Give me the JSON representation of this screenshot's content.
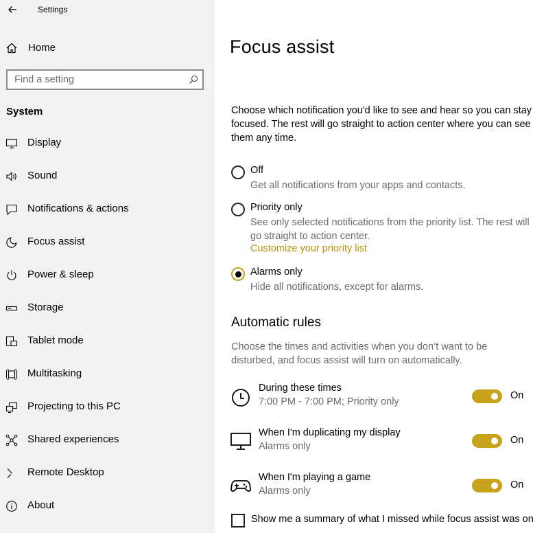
{
  "window": {
    "title": "Settings"
  },
  "sidebar": {
    "home_label": "Home",
    "search": {
      "placeholder": "Find a setting"
    },
    "section": "System",
    "items": [
      {
        "label": "Display",
        "icon": "display-icon"
      },
      {
        "label": "Sound",
        "icon": "speaker-icon"
      },
      {
        "label": "Notifications & actions",
        "icon": "notification-icon"
      },
      {
        "label": "Focus assist",
        "icon": "moon-icon"
      },
      {
        "label": "Power & sleep",
        "icon": "power-icon"
      },
      {
        "label": "Storage",
        "icon": "storage-icon"
      },
      {
        "label": "Tablet mode",
        "icon": "tablet-mode-icon"
      },
      {
        "label": "Multitasking",
        "icon": "multitasking-icon"
      },
      {
        "label": "Projecting to this PC",
        "icon": "projecting-icon"
      },
      {
        "label": "Shared experiences",
        "icon": "shared-experiences-icon"
      },
      {
        "label": "Remote Desktop",
        "icon": "remote-desktop-icon"
      },
      {
        "label": "About",
        "icon": "info-icon"
      }
    ]
  },
  "main": {
    "title": "Focus assist",
    "intro": "Choose which notification you'd like to see and hear so you can stay focused. The rest will go straight to action center where you can see them any time.",
    "options": [
      {
        "label": "Off",
        "description": "Get all notifications from your apps and contacts.",
        "selected": false
      },
      {
        "label": "Priority only",
        "description": "See only selected notifications from the priority list. The rest will go straight to action center.",
        "link": "Customize your priority list",
        "selected": false
      },
      {
        "label": "Alarms only",
        "description": "Hide all notifications, except for alarms.",
        "selected": true
      }
    ],
    "rules_title": "Automatic rules",
    "rules_description": "Choose the times and activities when you don’t want to be disturbed, and focus assist will turn on automatically.",
    "rules": [
      {
        "name": "During these times",
        "detail": "7:00 PM - 7:00 PM; Priority only",
        "state": "On",
        "icon": "clock-icon"
      },
      {
        "name": "When I'm duplicating my display",
        "detail": "Alarms only",
        "state": "On",
        "icon": "monitor-icon"
      },
      {
        "name": "When I'm playing a game",
        "detail": "Alarms only",
        "state": "On",
        "icon": "gamepad-icon"
      }
    ],
    "summary_checkbox": {
      "label": "Show me a summary of what I missed while focus assist was on",
      "checked": false
    }
  },
  "colors": {
    "accent": "#c7a21b",
    "link": "#b8920f",
    "sidebar_bg": "#f2f2f2",
    "secondary_text": "#6b6b6b"
  }
}
